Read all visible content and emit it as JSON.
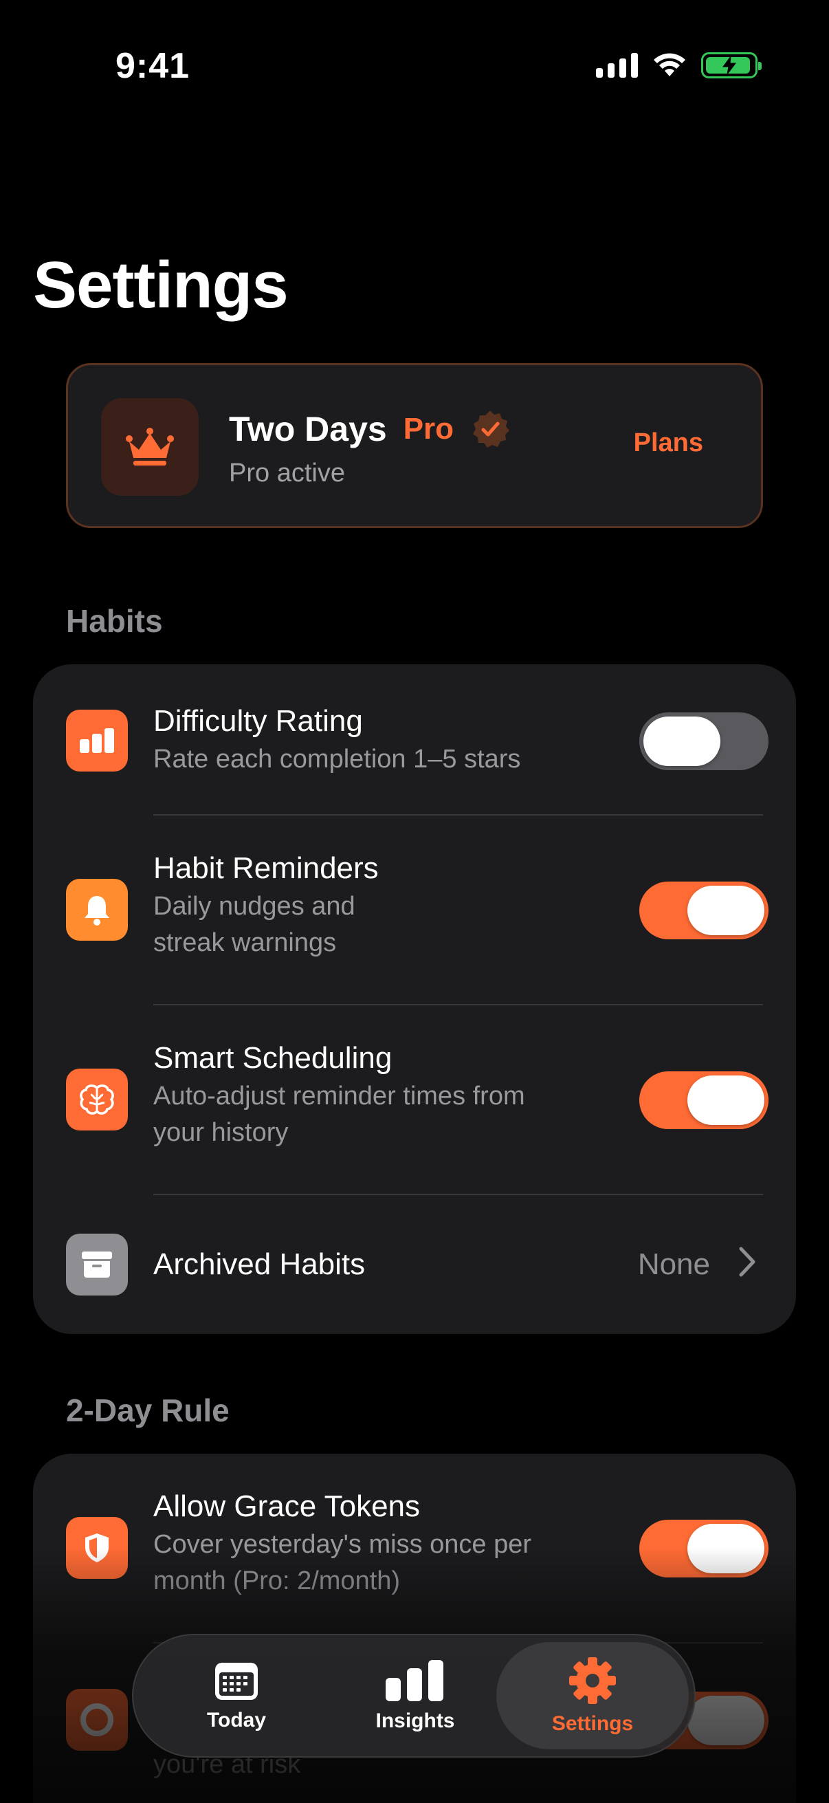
{
  "status_bar": {
    "time": "9:41"
  },
  "page": {
    "title": "Settings"
  },
  "pro_card": {
    "app_name": "Two Days",
    "tier": "Pro",
    "status": "Pro active",
    "action": "Plans"
  },
  "habits": {
    "header": "Habits",
    "rows": [
      {
        "title": "Difficulty Rating",
        "subtitle": "Rate each completion 1–5 stars",
        "toggle": false
      },
      {
        "title": "Habit Reminders",
        "subtitle_lines": [
          "Daily nudges and",
          "streak warnings"
        ],
        "toggle": true
      },
      {
        "title": "Smart Scheduling",
        "subtitle_lines": [
          "Auto-adjust reminder times from",
          "your history"
        ],
        "toggle": true
      },
      {
        "title": "Archived Habits",
        "value": "None"
      }
    ]
  },
  "two_day_rule": {
    "header": "2-Day Rule",
    "rows": [
      {
        "title": "Allow Grace Tokens",
        "subtitle_lines": [
          "Cover yesterday's miss once per",
          "month (Pro: 2/month)"
        ],
        "toggle": true
      },
      {
        "subtitle_partial": "you're at risk"
      }
    ]
  },
  "tab_bar": {
    "tabs": [
      {
        "label": "Today",
        "icon": "calendar-icon"
      },
      {
        "label": "Insights",
        "icon": "bar-chart-icon"
      },
      {
        "label": "Settings",
        "icon": "gear-icon",
        "active": true
      }
    ]
  },
  "colors": {
    "accent": "#ff6b35",
    "background": "#000000",
    "card": "#1c1c1e",
    "secondary_text": "#98989d",
    "battery": "#34c759"
  }
}
